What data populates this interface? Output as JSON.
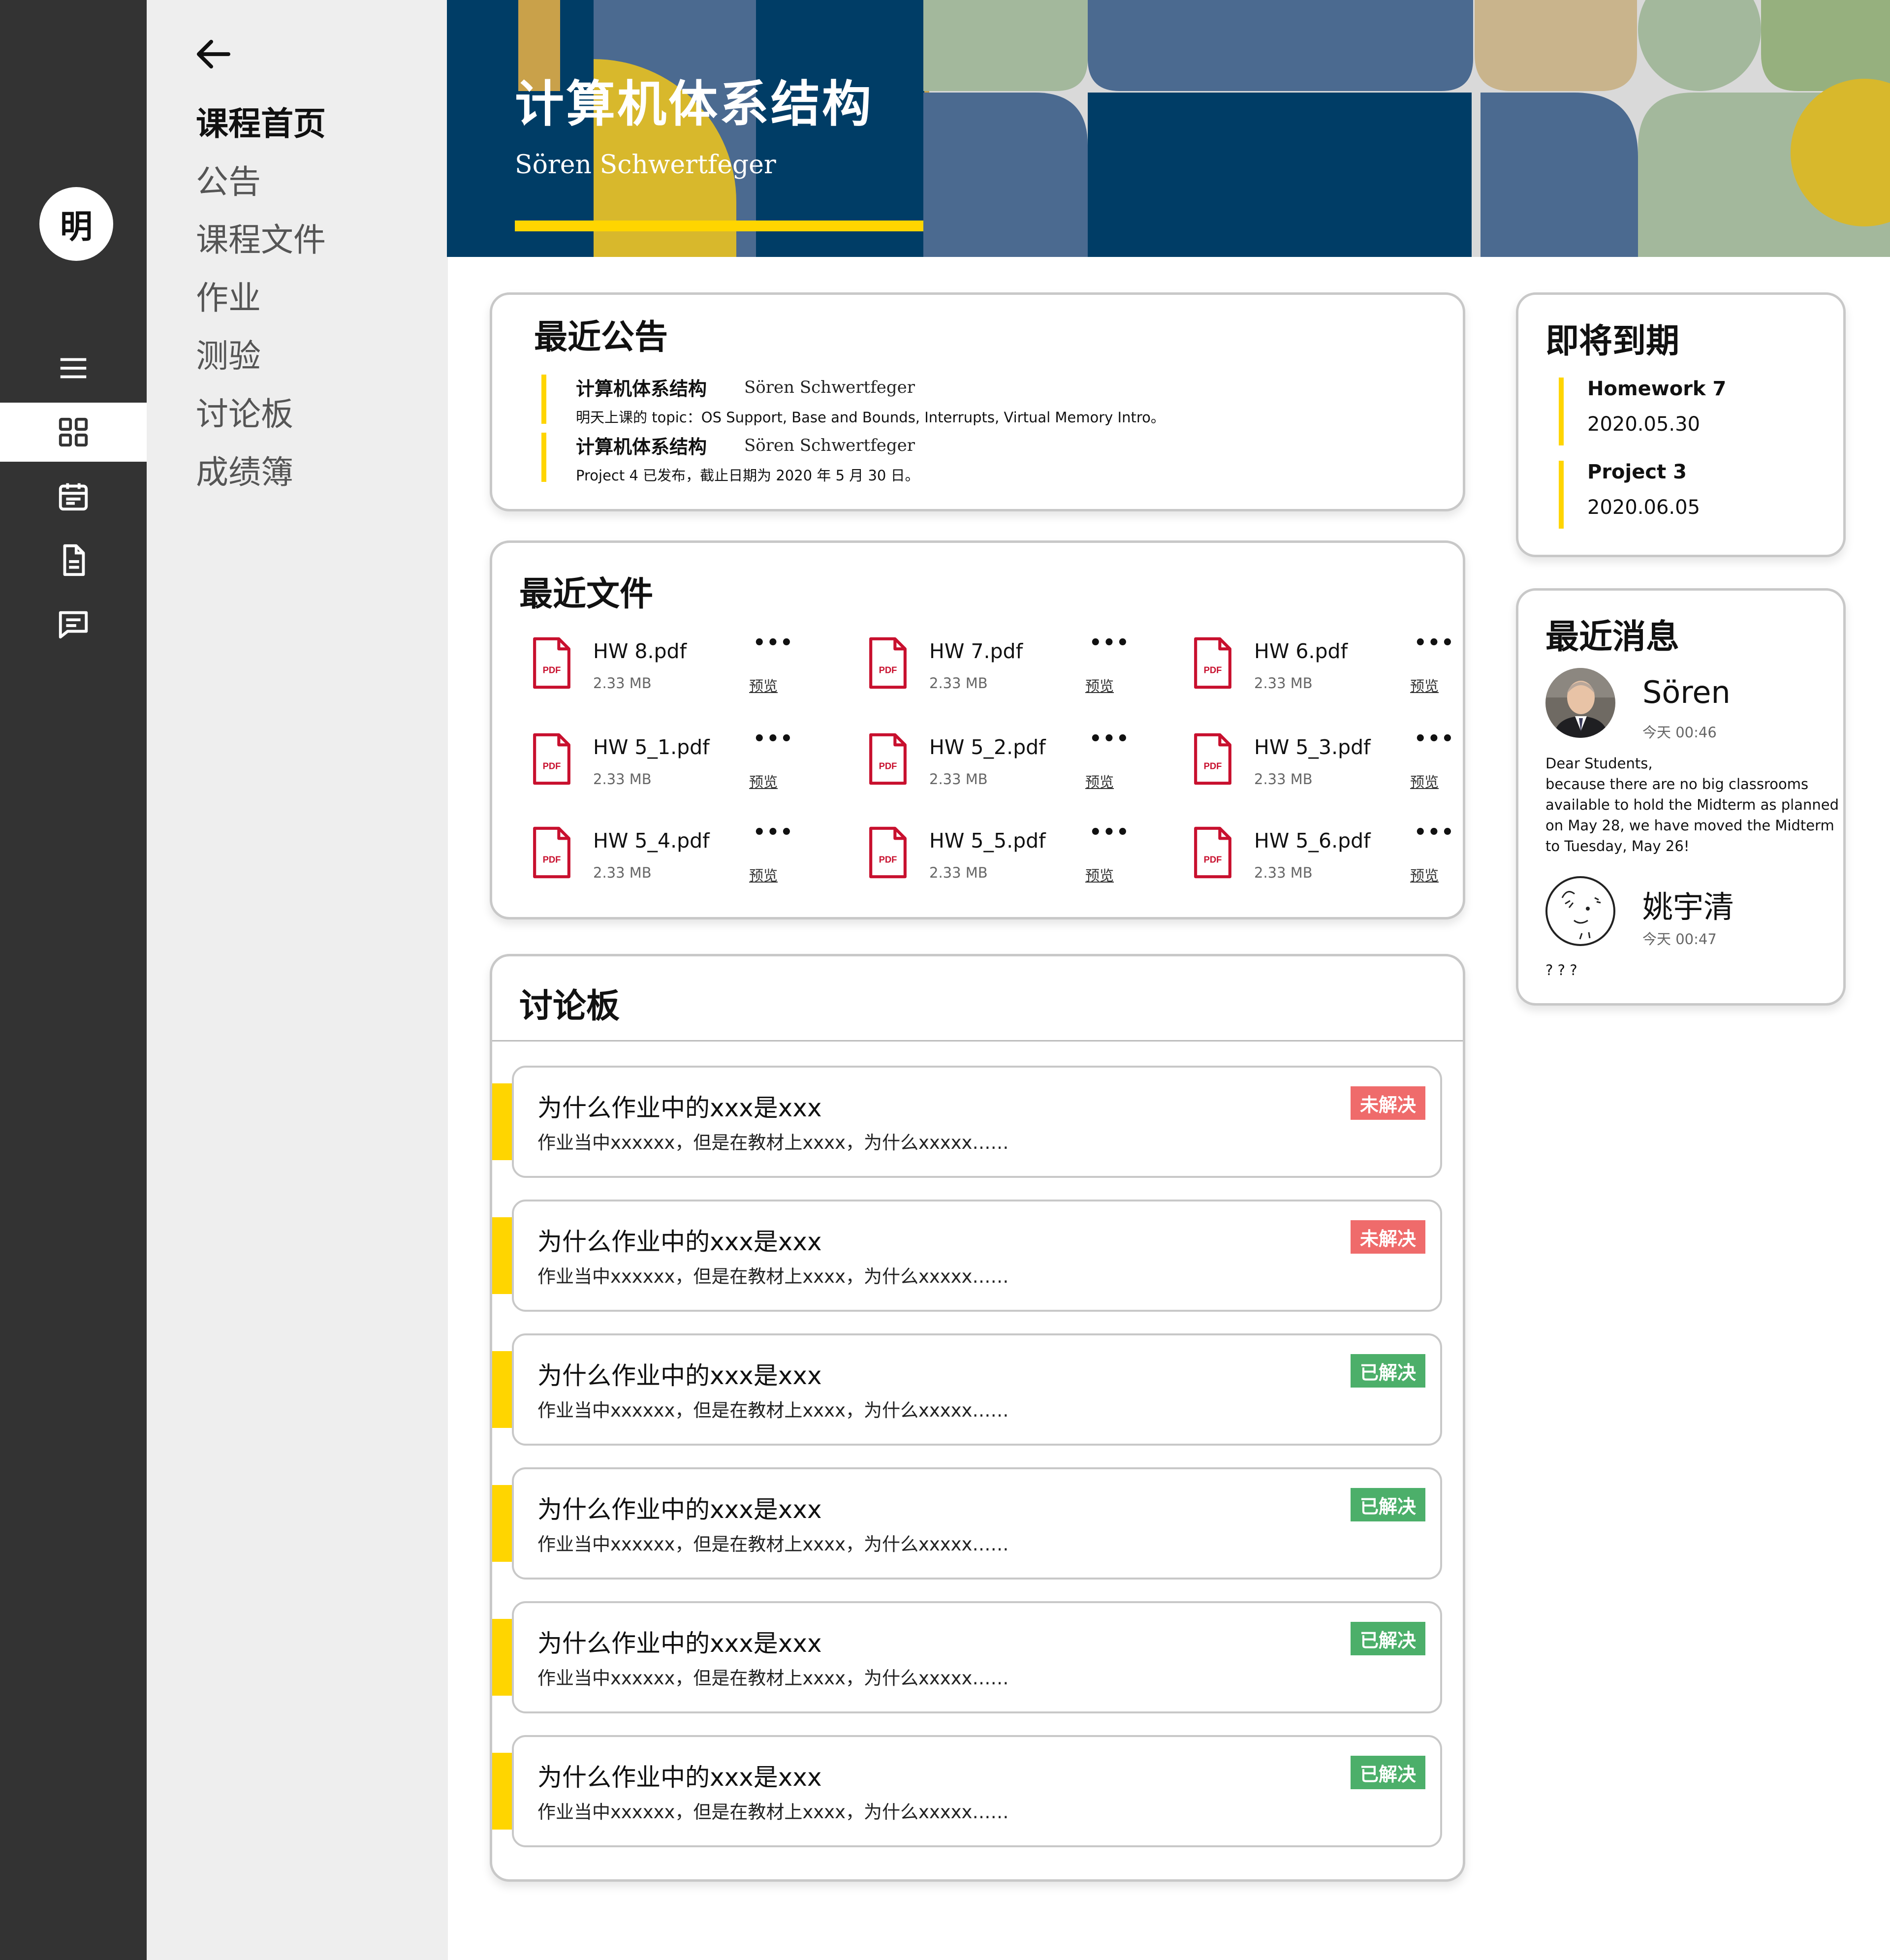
{
  "rail": {
    "logo_text": "明",
    "items": [
      {
        "icon": "menu-icon"
      },
      {
        "icon": "dashboard-grid-icon",
        "active": true
      },
      {
        "icon": "calendar-icon"
      },
      {
        "icon": "document-icon"
      },
      {
        "icon": "chat-icon"
      }
    ]
  },
  "nav": {
    "back_icon": "arrow-left-icon",
    "items": [
      "课程首页",
      "公告",
      "课程文件",
      "作业",
      "测验",
      "讨论板",
      "成绩簿"
    ],
    "active_index": 0
  },
  "banner": {
    "title": "计算机体系结构",
    "teacher": "Sören Schwertfeger",
    "accent_color": "#ffd500",
    "primary_color": "#003d66"
  },
  "announcements": {
    "title": "最近公告",
    "items": [
      {
        "course": "计算机体系结构",
        "author": "Sören Schwertfeger",
        "text": "明天上课的 topic：OS Support, Base and Bounds, Interrupts, Virtual Memory Intro。"
      },
      {
        "course": "计算机体系结构",
        "author": "Sören Schwertfeger",
        "text": "Project 4 已发布，截止日期为 2020 年 5 月 30 日。"
      }
    ]
  },
  "files": {
    "title": "最近文件",
    "more_label": "•••",
    "preview_label": "预览",
    "icon_label": "PDF",
    "items": [
      {
        "name": "HW 8.pdf",
        "size": "2.33 MB"
      },
      {
        "name": "HW 7.pdf",
        "size": "2.33 MB"
      },
      {
        "name": "HW 6.pdf",
        "size": "2.33 MB"
      },
      {
        "name": "HW 5_1.pdf",
        "size": "2.33 MB"
      },
      {
        "name": "HW 5_2.pdf",
        "size": "2.33 MB"
      },
      {
        "name": "HW 5_3.pdf",
        "size": "2.33 MB"
      },
      {
        "name": "HW 5_4.pdf",
        "size": "2.33 MB"
      },
      {
        "name": "HW 5_5.pdf",
        "size": "2.33 MB"
      },
      {
        "name": "HW 5_6.pdf",
        "size": "2.33 MB"
      }
    ]
  },
  "discussions": {
    "title": "讨论板",
    "status_colors": {
      "open": "#ef6b6b",
      "done": "#4caf6a"
    },
    "threads": [
      {
        "title": "为什么作业中的xxx是xxx",
        "text": "作业当中xxxxxx，但是在教材上xxxx，为什么xxxxx……",
        "status": "未解决",
        "state": "open"
      },
      {
        "title": "为什么作业中的xxx是xxx",
        "text": "作业当中xxxxxx，但是在教材上xxxx，为什么xxxxx……",
        "status": "未解决",
        "state": "open"
      },
      {
        "title": "为什么作业中的xxx是xxx",
        "text": "作业当中xxxxxx，但是在教材上xxxx，为什么xxxxx……",
        "status": "已解决",
        "state": "done"
      },
      {
        "title": "为什么作业中的xxx是xxx",
        "text": "作业当中xxxxxx，但是在教材上xxxx，为什么xxxxx……",
        "status": "已解决",
        "state": "done"
      },
      {
        "title": "为什么作业中的xxx是xxx",
        "text": "作业当中xxxxxx，但是在教材上xxxx，为什么xxxxx……",
        "status": "已解决",
        "state": "done"
      },
      {
        "title": "为什么作业中的xxx是xxx",
        "text": "作业当中xxxxxx，但是在教材上xxxx，为什么xxxxx……",
        "status": "已解决",
        "state": "done"
      }
    ]
  },
  "deadlines": {
    "title": "即将到期",
    "items": [
      {
        "name": "Homework 7",
        "date": "2020.05.30"
      },
      {
        "name": "Project 3",
        "date": "2020.06.05"
      }
    ]
  },
  "messages": {
    "title": "最近消息",
    "items": [
      {
        "name": "Sören",
        "time": "今天 00:46",
        "body": "Dear Students,\nbecause there are no big classrooms available to hold the Midterm as planned on May 28, we have moved the Midterm to Tuesday, May 26!",
        "avatar": "photo-avatar"
      },
      {
        "name": "姚宇清",
        "time": "今天 00:47",
        "body": "? ? ?",
        "avatar": "cartoon-avatar"
      }
    ]
  }
}
